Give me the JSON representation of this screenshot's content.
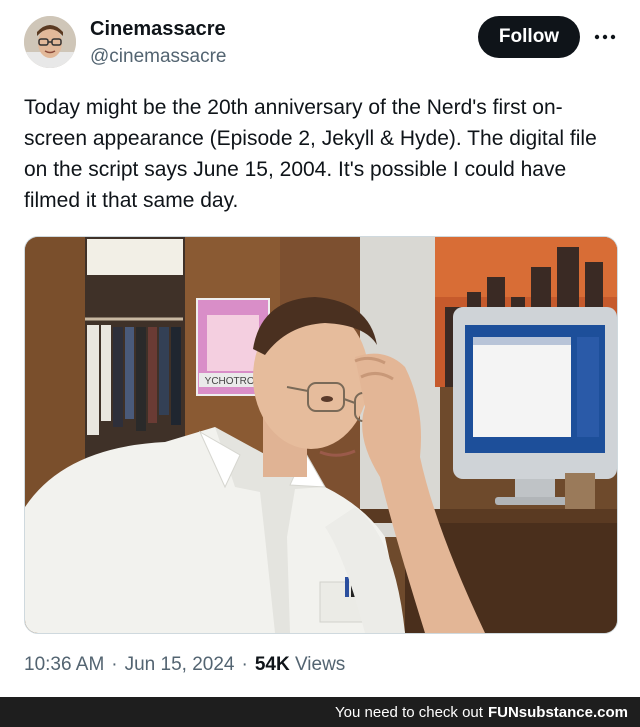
{
  "author": {
    "display_name": "Cinemassacre",
    "handle": "@cinemassacre",
    "avatar_icon": "avatar-photo-icon"
  },
  "follow_label": "Follow",
  "more_icon": "more-horizontal-icon",
  "tweet": {
    "text": "Today might be the 20th anniversary of the Nerd's first on-screen appearance (Episode 2, Jekyll & Hyde). The digital file on the script says June 15, 2004. It's possible I could have filmed it that same day.",
    "time": "10:36 AM",
    "separator": "·",
    "date": "Jun 15, 2024",
    "views_count": "54K",
    "views_label": "Views"
  },
  "media": {
    "poster_text": "YCHOTROP"
  },
  "watermark": {
    "prefix": "You need to check out",
    "brand": "FUNsubstance.com"
  },
  "colors": {
    "text": "#0f1419",
    "secondary": "#536471",
    "follow_bg": "#0f1419",
    "footer_bg": "#1e1e1e"
  }
}
